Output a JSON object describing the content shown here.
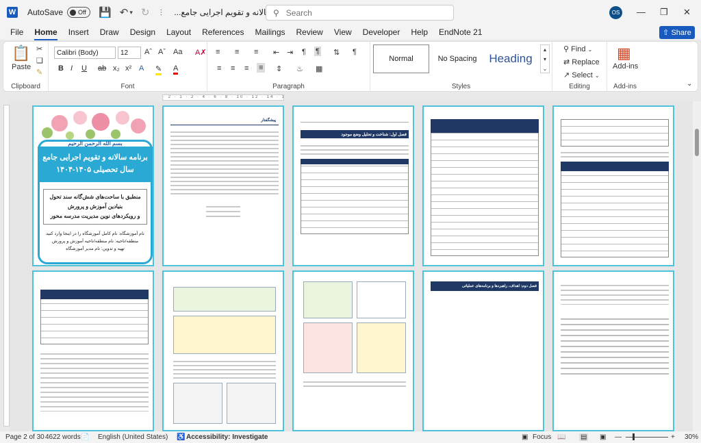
{
  "titlebar": {
    "autosave_label": "AutoSave",
    "autosave_state": "Off",
    "doc_title": "برنامه سالانه و تقویم اجرایی جامع...",
    "search_placeholder": "Search",
    "user_initials": "OS"
  },
  "menu": {
    "tabs": [
      "File",
      "Home",
      "Insert",
      "Draw",
      "Design",
      "Layout",
      "References",
      "Mailings",
      "Review",
      "View",
      "Developer",
      "Help",
      "EndNote 21"
    ],
    "active": "Home",
    "share_label": "Share"
  },
  "ribbon": {
    "clipboard": {
      "paste_label": "Paste",
      "group_label": "Clipboard"
    },
    "font": {
      "font_name": "Calibri (Body)",
      "font_size": "12",
      "group_label": "Font"
    },
    "paragraph": {
      "group_label": "Paragraph"
    },
    "styles": {
      "items": [
        "Normal",
        "No Spacing",
        "Heading"
      ],
      "group_label": "Styles"
    },
    "editing": {
      "find_label": "Find",
      "replace_label": "Replace",
      "select_label": "Select",
      "group_label": "Editing"
    },
    "addins": {
      "label": "Add-ins",
      "group_label": "Add-ins"
    }
  },
  "ruler_text": "· 2 · 1 · 2 · 4 · 6 · 8 · 10 · 12 · 14 · 16 ·",
  "cover": {
    "calligraphy": "بسم الله الرحمن الرحیم",
    "title_line1": "برنامه سالانه و تقویم اجرایی جامع",
    "title_line2": "سال تحصیلی ۱۴۰۵-۱۴۰۴",
    "subtitle_line1": "منطبق با ساحت‌های شش‌گانه سند تحول",
    "subtitle_line2": "بنیادین آموزش و پرورش",
    "subtitle_line3": "و رویکردهای نوین مدیریت مدرسه محور",
    "info_line1": "نام آموزشگاه: نام کامل آموزشگاه را در اینجا وارد کنید",
    "info_line2": "منطقه/ناحیه: نام منطقه/ناحیه آموزش و پرورش",
    "info_line3": "تهیه و تدوین: نام مدیر آموزشگاه"
  },
  "pages": {
    "p2_title": "پیشگفتار",
    "p3_title": "فصل اول: شناخت و تحلیل وضع موجود",
    "p9_title": "فصل دوم: اهداف، راهبردها و برنامه‌های عملیاتی"
  },
  "status": {
    "page": "Page 2 of 30",
    "words": "4622 words",
    "language": "English (United States)",
    "accessibility": "Accessibility: Investigate",
    "focus": "Focus",
    "zoom": "30%"
  }
}
